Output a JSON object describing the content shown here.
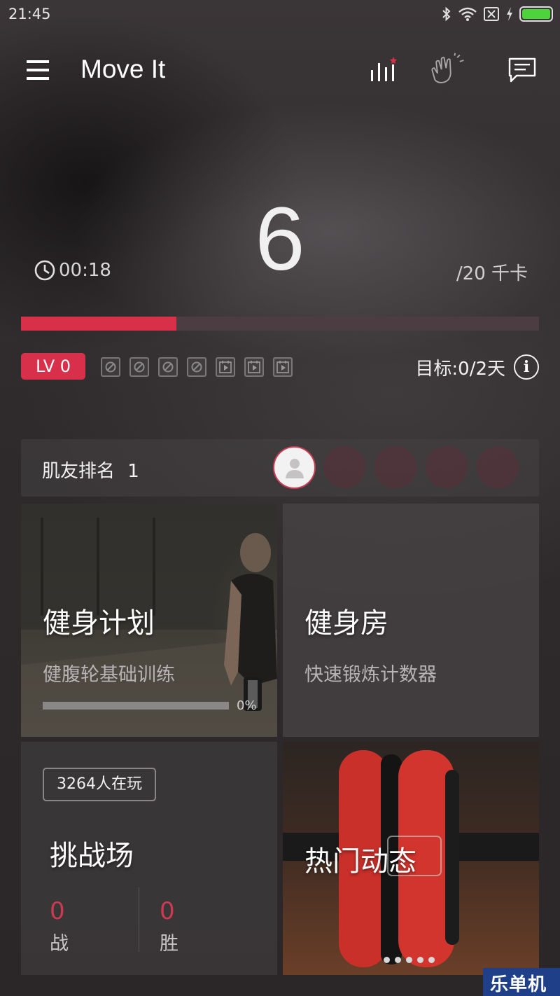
{
  "status_bar": {
    "time": "21:45",
    "icons": [
      "bluetooth-icon",
      "wifi-icon",
      "no-sim-icon",
      "charging-icon",
      "battery-icon"
    ],
    "battery_color": "#4cd43a"
  },
  "app_bar": {
    "title": "Move It",
    "actions": [
      "ranking-chart-icon",
      "clap-icon",
      "message-icon"
    ]
  },
  "calories": {
    "current": "6",
    "goal_text": "/20 千卡",
    "elapsed_time": "00:18",
    "progress_fraction": 0.3,
    "accent_color": "#d83048"
  },
  "level": {
    "badge": "LV 0",
    "stamps": [
      "disabled",
      "disabled",
      "disabled",
      "disabled",
      "play",
      "play",
      "play"
    ],
    "goal_days": "目标:0/2天"
  },
  "ranking": {
    "label": "肌友排名",
    "rank": "1"
  },
  "tiles": {
    "plan": {
      "title": "健身计划",
      "subtitle": "健腹轮基础训练",
      "progress_label": "0%",
      "progress_fraction": 0
    },
    "gym": {
      "title": "健身房",
      "subtitle": "快速锻炼计数器"
    },
    "arena": {
      "players_badge": "3264人在玩",
      "title": "挑战场",
      "battles_value": "0",
      "battles_label": "战",
      "wins_value": "0",
      "wins_label": "胜"
    },
    "hot": {
      "title": "热门动态",
      "carousel_pages": 5
    }
  },
  "watermark": "乐单机"
}
